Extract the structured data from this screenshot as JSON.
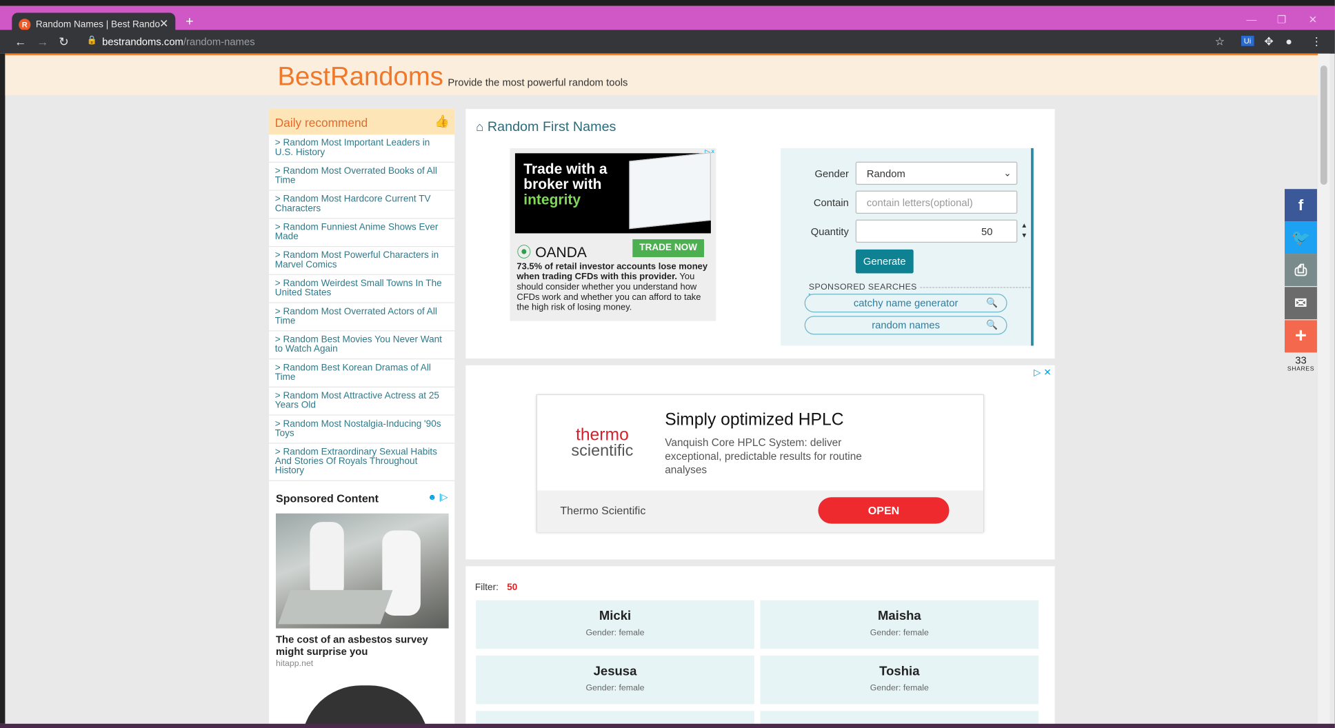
{
  "browser": {
    "tab_title": "Random Names | Best Random T",
    "favicon_letter": "R",
    "url_host": "bestrandoms.com",
    "url_path": "/random-names"
  },
  "site": {
    "logo": "BestRandoms",
    "tagline": "Provide the most powerful random tools"
  },
  "sidebar": {
    "heading": "Daily recommend",
    "items": [
      "> Random Most Important Leaders in U.S. History",
      "> Random Most Overrated Books of All Time",
      "> Random Most Hardcore Current TV Characters",
      "> Random Funniest Anime Shows Ever Made",
      "> Random Most Powerful Characters in Marvel Comics",
      "> Random Weirdest Small Towns In The United States",
      "> Random Most Overrated Actors of All Time",
      "> Random Best Movies You Never Want to Watch Again",
      "> Random Best Korean Dramas of All Time",
      "> Random Most Attractive Actress at 25 Years Old",
      "> Random Most Nostalgia-Inducing '90s Toys",
      "> Random Extraordinary Sexual Habits And Stories Of Royals Throughout History"
    ],
    "sponsored_title": "Sponsored Content",
    "sponsored_caption": "The cost of an asbestos survey might surprise you",
    "sponsored_source": "hitapp.net"
  },
  "main": {
    "title": "Random First Names",
    "ad1": {
      "headline_1": "Trade with a",
      "headline_2": "broker with",
      "headline_3": "integrity",
      "brand": "OANDA",
      "cta": "TRADE NOW",
      "disclaimer_bold": "73.5% of retail investor accounts lose money when trading CFDs with this provider.",
      "disclaimer": "You should consider whether you understand how CFDs work and whether you can afford to take the high risk of losing money."
    },
    "form": {
      "gender_label": "Gender",
      "gender_value": "Random",
      "contain_label": "Contain",
      "contain_placeholder": "contain letters(optional)",
      "quantity_label": "Quantity",
      "quantity_value": "50",
      "generate": "Generate",
      "sponsored_searches": "SPONSORED SEARCHES",
      "search_1": "catchy name generator",
      "search_2": "random names"
    },
    "ad2": {
      "brand_1": "thermo",
      "brand_2": "scientific",
      "title": "Simply optimized HPLC",
      "description": "Vanquish Core HPLC System: deliver exceptional, predictable results for routine analyses",
      "advertiser": "Thermo Scientific",
      "cta": "OPEN"
    },
    "results": {
      "filter_label": "Filter:",
      "count": "50",
      "names": [
        {
          "name": "Micki",
          "gender": "Gender: female"
        },
        {
          "name": "Maisha",
          "gender": "Gender: female"
        },
        {
          "name": "Jesusa",
          "gender": "Gender: female"
        },
        {
          "name": "Toshia",
          "gender": "Gender: female"
        }
      ]
    }
  },
  "share": {
    "count": "33",
    "label": "SHARES",
    "colors": {
      "facebook": "#3b5998",
      "twitter": "#1da1f2",
      "print": "#7a8b8c",
      "email": "#6b6b6b",
      "more": "#f4684d"
    }
  }
}
